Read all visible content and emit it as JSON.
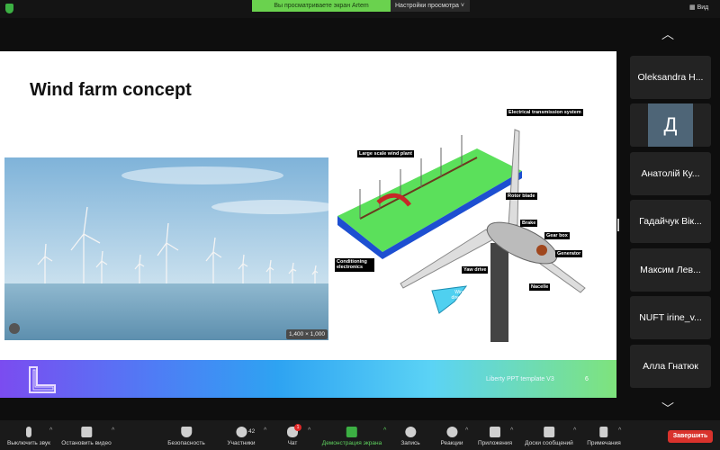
{
  "topbar": {
    "viewing_banner": "Вы просматриваете экран Artem",
    "view_settings": "Настройки просмотра ˅",
    "view_button": "Вид"
  },
  "slide": {
    "title": "Wind farm concept",
    "photo_size": "1,400 × 1,000",
    "diagram_labels": [
      "Electrical transmission system",
      "Large scale wind plant",
      "Rotor blade",
      "Brake",
      "Gear box",
      "Generator",
      "Yaw drive",
      "Nacelle",
      "Conditioning electronics",
      "Wind direction"
    ],
    "footer_template": "Liberty PPT template V3",
    "page_number": "6"
  },
  "participants": [
    {
      "name": "Oleksandra H..."
    },
    {
      "name": "",
      "avatar": "Д"
    },
    {
      "name": "Анатолій Ку..."
    },
    {
      "name": "Гадайчук Вік..."
    },
    {
      "name": "Максим Лев..."
    },
    {
      "name": "NUFT irine_v..."
    },
    {
      "name": "Алла Гнатюк"
    }
  ],
  "toolbar": {
    "mute": "Выключить звук",
    "stop_video": "Остановить видео",
    "security": "Безопасность",
    "participants": "Участники",
    "participants_count": "42",
    "chat": "Чат",
    "chat_badge": "1",
    "share": "Демонстрация экрана",
    "record": "Запись",
    "reactions": "Реакции",
    "apps": "Приложения",
    "whiteboards": "Доски сообщений",
    "notes": "Примечания",
    "end": "Завершить"
  }
}
